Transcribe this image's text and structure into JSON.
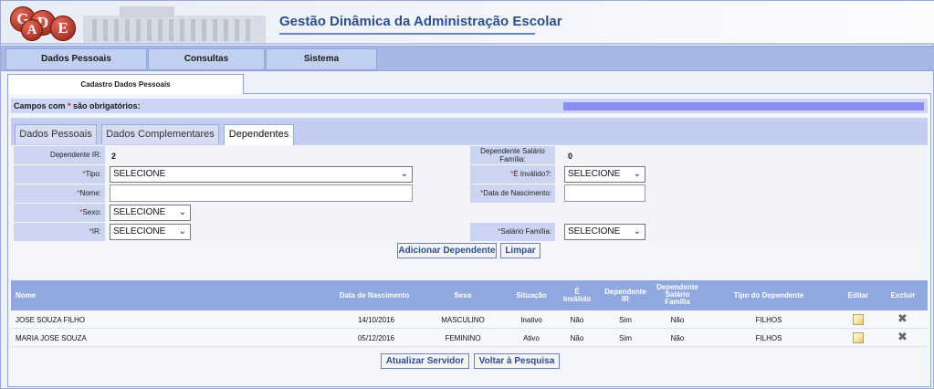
{
  "header": {
    "logo_letters": [
      "G",
      "D",
      "A",
      "E"
    ],
    "title": "Gestão Dinâmica da Administração Escolar"
  },
  "menu": {
    "items": [
      "Dados Pessoais",
      "Consultas",
      "Sistema"
    ]
  },
  "page_tab": "Cadastro Dados Pessoais",
  "required_note": {
    "prefix": "Campos com ",
    "star": "*",
    "suffix": " são obrigatórios:"
  },
  "subtabs": [
    "Dados Pessoais",
    "Dados Complementares",
    "Dependentes"
  ],
  "form": {
    "dependente_ir_label": "Dependente IR:",
    "dependente_ir_value": "2",
    "dependente_sf_label": "Dependente Salário Família:",
    "dependente_sf_value": "0",
    "tipo_label": "Tipo:",
    "tipo_value": "SELECIONE",
    "invalido_label": "É Inválido?:",
    "invalido_value": "SELECIONE",
    "nome_label": "Nome:",
    "nome_value": "",
    "nasc_label": "Data de Nascimento:",
    "nasc_value": "",
    "sexo_label": "Sexo:",
    "sexo_value": "SELECIONE",
    "ir_label": "IR:",
    "ir_value": "SELECIONE",
    "sf_label": "Salário Família:",
    "sf_value": "SELECIONE",
    "star": "*"
  },
  "buttons": {
    "add": "Adicionar Dependente",
    "clear": "Limpar",
    "update": "Atualizar Servidor",
    "back": "Voltar à Pesquisa"
  },
  "table": {
    "headers": {
      "nome": "Nome",
      "nasc": "Data de Nascimento",
      "sexo": "Sexo",
      "situacao": "Situação",
      "invalido": [
        "É",
        "Inválido"
      ],
      "dep_ir": [
        "Dependente",
        "IR"
      ],
      "dep_sf": [
        "Dependente",
        "Salário",
        "Família"
      ],
      "tipo": "Tipo do Dependente",
      "editar": "Editar",
      "excluir": "Excluir"
    },
    "rows": [
      {
        "nome": "JOSE SOUZA FILHO",
        "nasc": "14/10/2016",
        "sexo": "MASCULINO",
        "situacao": "Inativo",
        "invalido": "Não",
        "dep_ir": "Sim",
        "dep_sf": "Não",
        "tipo": "FILHOS"
      },
      {
        "nome": "MARIA JOSE SOUZA",
        "nasc": "05/12/2016",
        "sexo": "FEMININO",
        "situacao": "Ativo",
        "invalido": "Não",
        "dep_ir": "Sim",
        "dep_sf": "Não",
        "tipo": "FILHOS"
      }
    ]
  },
  "icons": {
    "edit": "edit-pencil-icon",
    "delete": "delete-x-icon"
  },
  "colors": {
    "header_title": "#2d4f8e",
    "menu_bg": "#a6b8e6",
    "table_header": "#90a8e0",
    "required_star": "#d42020",
    "progress_bar": "#8c8cf2"
  }
}
